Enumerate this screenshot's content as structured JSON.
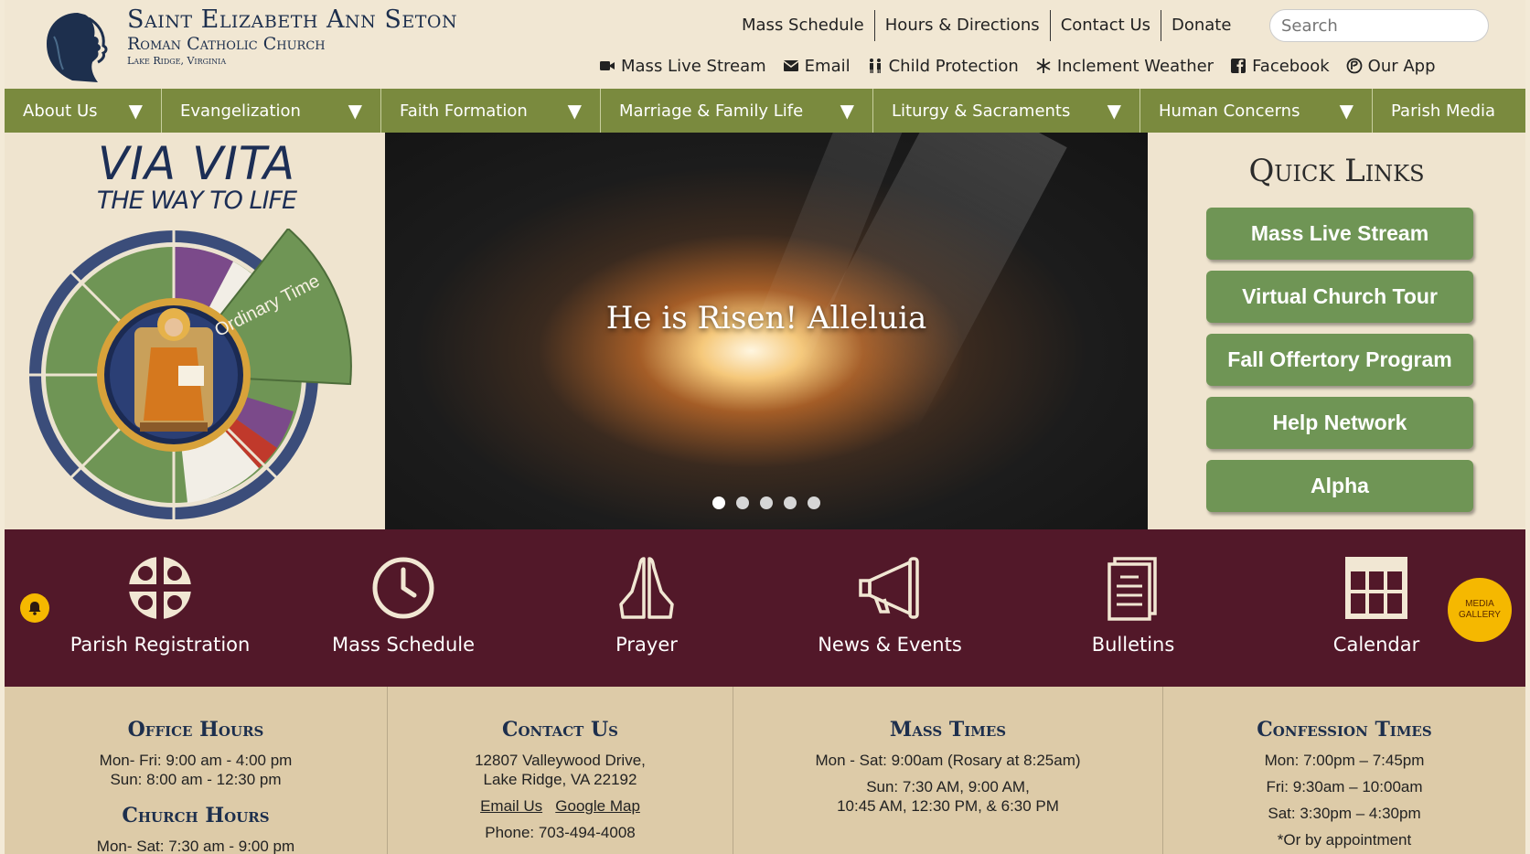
{
  "header": {
    "title": "Saint Elizabeth Ann Seton",
    "subtitle": "Roman Catholic Church",
    "location": "Lake Ridge, Virginia",
    "top_links": [
      "Mass Schedule",
      "Hours & Directions",
      "Contact Us",
      "Donate"
    ],
    "search_placeholder": "Search",
    "util_links": [
      {
        "label": "Mass Live Stream",
        "icon": "video-camera-icon"
      },
      {
        "label": "Email",
        "icon": "envelope-icon"
      },
      {
        "label": "Child Protection",
        "icon": "children-icon"
      },
      {
        "label": "Inclement Weather",
        "icon": "snowflake-icon"
      },
      {
        "label": "Facebook",
        "icon": "facebook-icon"
      },
      {
        "label": "Our App",
        "icon": "app-icon"
      }
    ]
  },
  "nav": [
    "About Us",
    "Evangelization",
    "Faith Formation",
    "Marriage & Family Life",
    "Liturgy & Sacraments",
    "Human Concerns",
    "Parish Media"
  ],
  "via_vita": {
    "line1": "VIA VITA",
    "line2": "THE WAY TO LIFE",
    "season": "Ordinary Time"
  },
  "hero": {
    "title": "He is Risen! Alleluia",
    "slide_count": 5,
    "active_slide": 1
  },
  "quick_links": {
    "title": "Quick Links",
    "items": [
      "Mass Live Stream",
      "Virtual Church Tour",
      "Fall Offertory Program",
      "Help Network",
      "Alpha"
    ]
  },
  "band": {
    "items": [
      "Parish Registration",
      "Mass Schedule",
      "Prayer",
      "News & Events",
      "Bulletins",
      "Calendar"
    ],
    "media_gallery_line1": "MEDIA",
    "media_gallery_line2": "GALLERY"
  },
  "info": {
    "office_hours": {
      "title": "Office Hours",
      "line1": "Mon- Fri: 9:00 am - 4:00 pm",
      "line2": "Sun: 8:00 am - 12:30 pm"
    },
    "church_hours": {
      "title": "Church Hours",
      "line1": "Mon- Sat: 7:30 am - 9:00 pm"
    },
    "contact": {
      "title": "Contact Us",
      "address1": "12807 Valleywood Drive,",
      "address2": "Lake Ridge, VA 22192",
      "email_link": "Email Us",
      "map_link": "Google Map",
      "phone": "Phone: 703-494-4008"
    },
    "mass_times": {
      "title": "Mass Times",
      "line1": "Mon - Sat: 9:00am (Rosary at 8:25am)",
      "line2": "Sun: 7:30 AM, 9:00 AM,",
      "line3": "10:45 AM, 12:30 PM, & 6:30 PM"
    },
    "confession": {
      "title": "Confession Times",
      "line1": "Mon: 7:00pm – 7:45pm",
      "line2": "Fri: 9:30am – 10:00am",
      "line3": "Sat: 3:30pm – 4:30pm",
      "line4": "*Or by appointment"
    }
  },
  "colors": {
    "nav": "#7a8a3e",
    "band": "#521829",
    "quick_link_button": "#6f9555",
    "accent_yellow": "#f5b800",
    "navy": "#1d2f4d"
  }
}
